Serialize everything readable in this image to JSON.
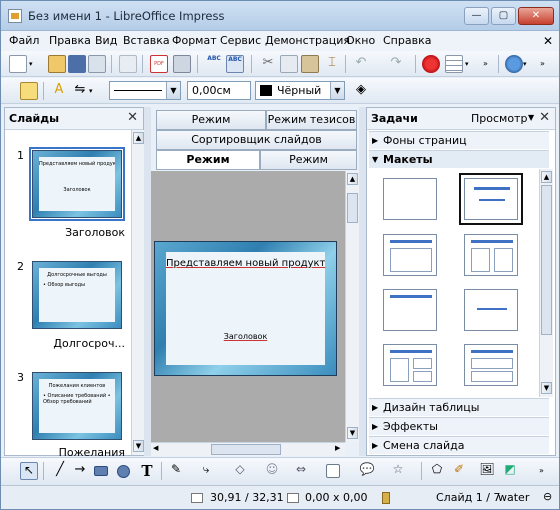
{
  "window": {
    "title": "Без имени 1 - LibreOffice Impress",
    "min": "—",
    "max": "▢",
    "close": "✕"
  },
  "menu": [
    "Файл",
    "Правка",
    "Вид",
    "Вставка",
    "Формат",
    "Сервис",
    "Демонстрация",
    "Окно",
    "Справка"
  ],
  "format_toolbar": {
    "line_width": "0,00см",
    "color_name": "Чёрный"
  },
  "slides_pane": {
    "title": "Слайды",
    "slides": [
      {
        "num": "1",
        "caption": "Заголовок",
        "title": "Представляем новый продукт",
        "sub": "Заголовок"
      },
      {
        "num": "2",
        "caption": "Долгосроч...",
        "title": "Долгосрочные выгоды",
        "sub": "• Обзор выгоды"
      },
      {
        "num": "3",
        "caption": "Пожелания",
        "title": "Пожелания клиентов",
        "sub": "• Описание требований • Обзор требований"
      }
    ]
  },
  "center": {
    "tabs": [
      "Режим примечаний",
      "Режим тезисов",
      "Сортировщик слайдов",
      "Режим рисования",
      "Режим структуры"
    ],
    "slide_title": "Представляем новый продукт",
    "slide_sub": "Заголовок"
  },
  "tasks": {
    "title": "Задачи",
    "view": "Просмотр",
    "master_pages": "Фоны страниц",
    "layouts": "Макеты",
    "table_design": "Дизайн таблицы",
    "effects": "Эффекты",
    "transition": "Смена слайда"
  },
  "status": {
    "position": "30,91 / 32,31",
    "size": "0,00 x 0,00",
    "slide": "Слайд 1 / 7",
    "theme": "water"
  }
}
